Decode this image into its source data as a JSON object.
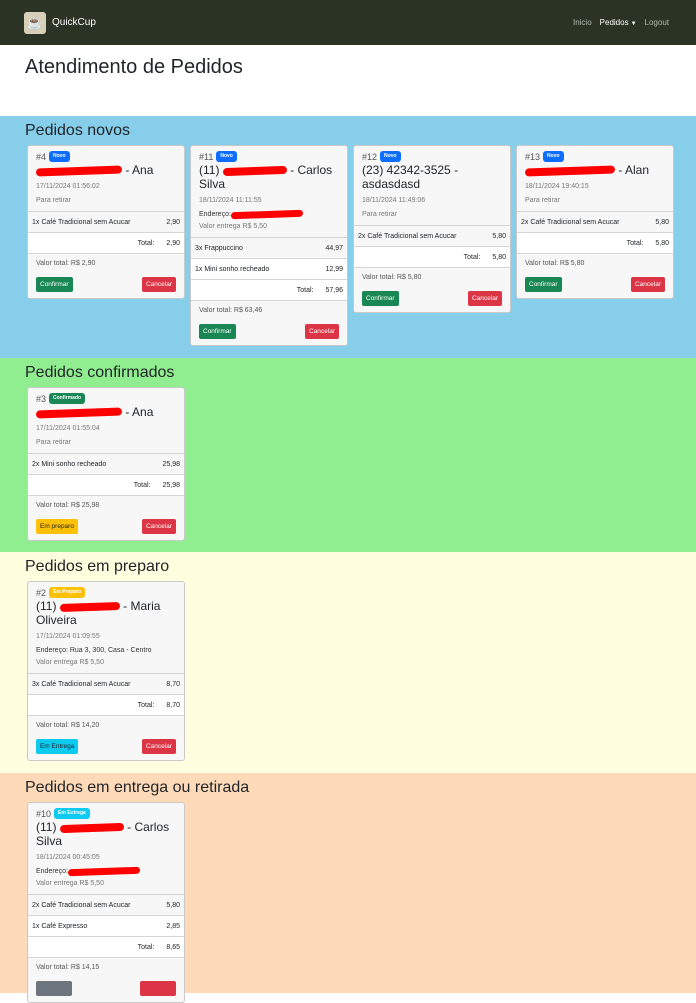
{
  "nav": {
    "brand": "QuickCup",
    "links": [
      "Inicio",
      "Pedidos",
      "Logout"
    ]
  },
  "page_title": "Atendimento de Pedidos",
  "sections": {
    "novos": {
      "title": "Pedidos novos",
      "cards": [
        {
          "number": "#4",
          "badge": "Novo",
          "customer_suffix": "- Ana",
          "datetime": "17/11/2024 01:56:02",
          "mode": "Para retirar",
          "items": [
            {
              "name": "1x Café Tradicional sem Acucar",
              "price": "2,90"
            }
          ],
          "total_label": "Total:",
          "total": "2,90",
          "value_total": "Valor total: R$ 2,90",
          "btn_primary": "Confirmar",
          "btn_cancel": "Cancelar"
        },
        {
          "number": "#11",
          "badge": "Novo",
          "customer_prefix": "(11)",
          "customer_suffix": "- Carlos Silva",
          "datetime": "18/11/2024 11:11:55",
          "address_label": "Endereço:",
          "delivery": "Valor entrega R$ 5,50",
          "items": [
            {
              "name": "3x Frappuccino",
              "price": "44,97"
            },
            {
              "name": "1x Mini sonho recheado",
              "price": "12,99"
            }
          ],
          "total_label": "Total:",
          "total": "57,96",
          "value_total": "Valor total: R$ 63,46",
          "btn_primary": "Confirmar",
          "btn_cancel": "Cancelar"
        },
        {
          "number": "#12",
          "badge": "Novo",
          "customer_full": "(23) 42342-3525 - asdasdasd",
          "datetime": "18/11/2024 11:49:06",
          "mode": "Para retirar",
          "items": [
            {
              "name": "2x Café Tradicional sem Acucar",
              "price": "5,80"
            }
          ],
          "total_label": "Total:",
          "total": "5,80",
          "value_total": "Valor total: R$ 5,80",
          "btn_primary": "Confirmar",
          "btn_cancel": "Cancelar"
        },
        {
          "number": "#13",
          "badge": "Novo",
          "customer_suffix": "- Alan",
          "datetime": "18/11/2024 19:40:15",
          "mode": "Para retirar",
          "items": [
            {
              "name": "2x Café Tradicional sem Acucar",
              "price": "5,80"
            }
          ],
          "total_label": "Total:",
          "total": "5,80",
          "value_total": "Valor total: R$ 5,80",
          "btn_primary": "Confirmar",
          "btn_cancel": "Cancelar"
        }
      ]
    },
    "confirmados": {
      "title": "Pedidos confirmados",
      "cards": [
        {
          "number": "#3",
          "badge": "Confirmado",
          "customer_suffix": "- Ana",
          "datetime": "17/11/2024 01:55:04",
          "mode": "Para retirar",
          "items": [
            {
              "name": "2x Mini sonho recheado",
              "price": "25,98"
            }
          ],
          "total_label": "Total:",
          "total": "25,98",
          "value_total": "Valor total: R$ 25,98",
          "btn_primary": "Em preparo",
          "btn_cancel": "Cancelar"
        }
      ]
    },
    "preparo": {
      "title": "Pedidos em preparo",
      "cards": [
        {
          "number": "#2",
          "badge": "Em Preparo",
          "customer_prefix": "(11)",
          "customer_suffix": "- Maria Oliveira",
          "datetime": "17/11/2024 01:09:55",
          "address": "Endereço: Rua 3, 300, Casa - Centro",
          "delivery": "Valor entrega R$ 5,50",
          "items": [
            {
              "name": "3x Café Tradicional sem Acucar",
              "price": "8,70"
            }
          ],
          "total_label": "Total:",
          "total": "8,70",
          "value_total": "Valor total: R$ 14,20",
          "btn_primary": "Em Entrega",
          "btn_cancel": "Cancelar"
        }
      ]
    },
    "entrega": {
      "title": "Pedidos em entrega ou retirada",
      "cards": [
        {
          "number": "#10",
          "badge": "Em Entrega",
          "customer_prefix": "(11)",
          "customer_suffix": "- Carlos Silva",
          "datetime": "18/11/2024 00:45:05",
          "address_label": "Endereço:",
          "delivery": "Valor entrega R$ 5,50",
          "items": [
            {
              "name": "2x Café Tradicional sem Acucar",
              "price": "5,80"
            },
            {
              "name": "1x Café Expresso",
              "price": "2,85"
            }
          ],
          "total_label": "Total:",
          "total": "8,65",
          "value_total": "Valor total: R$ 14,15"
        }
      ]
    }
  }
}
